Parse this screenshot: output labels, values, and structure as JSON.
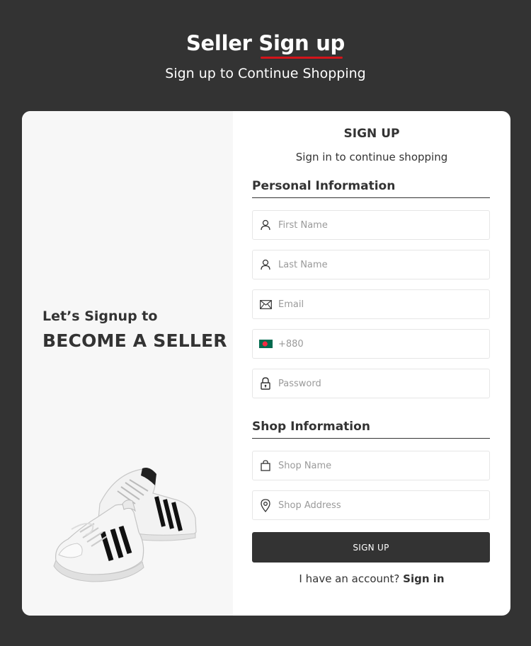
{
  "header": {
    "title_part1": "Seller",
    "title_part2": "Sign up",
    "subtitle": "Sign up to Continue Shopping"
  },
  "promo": {
    "line1": "Let’s Signup to",
    "line2": "BECOME A SELLER"
  },
  "form": {
    "title": "SIGN UP",
    "subtitle": "Sign in to continue shopping",
    "personal_heading": "Personal Information",
    "shop_heading": "Shop Information",
    "fields": {
      "first_name": {
        "placeholder": "First Name",
        "value": "",
        "icon": "user-icon"
      },
      "last_name": {
        "placeholder": "Last Name",
        "value": "",
        "icon": "user-icon"
      },
      "email": {
        "placeholder": "Email",
        "value": "",
        "icon": "envelope-icon"
      },
      "phone": {
        "placeholder": "+880",
        "value": "",
        "icon": "bangladesh-flag-icon"
      },
      "password": {
        "placeholder": "Password",
        "value": "",
        "icon": "lock-icon"
      },
      "shop_name": {
        "placeholder": "Shop Name",
        "value": "",
        "icon": "shopping-bag-icon"
      },
      "shop_address": {
        "placeholder": "Shop Address",
        "value": "",
        "icon": "map-pin-icon"
      }
    },
    "submit_label": "SIGN UP",
    "footer_prompt": "I have an account?",
    "footer_link": "Sign in"
  },
  "colors": {
    "background": "#333333",
    "accent_underline": "#d4141a",
    "card": "#ffffff",
    "left_panel": "#f7f7f7",
    "button": "#333333"
  }
}
